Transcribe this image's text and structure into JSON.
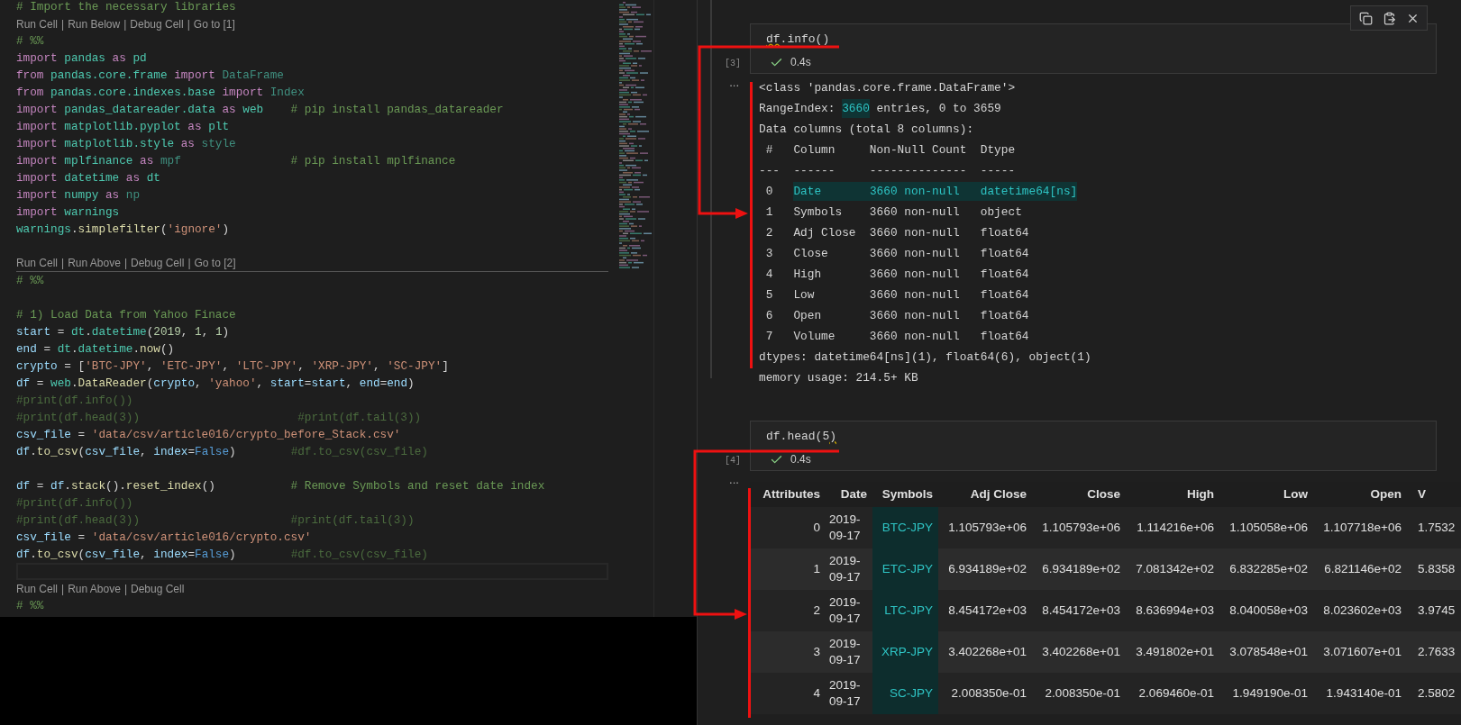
{
  "editor": {
    "codelens_separator": "|",
    "lines": [
      {
        "kind": "code",
        "segments": [
          {
            "kind": "cmt",
            "text": "# Import the necessary libraries"
          }
        ]
      },
      {
        "kind": "codelens",
        "divider": false,
        "items": [
          "Run Cell",
          "Run Below",
          "Debug Cell",
          "Go to [1]"
        ]
      },
      {
        "kind": "code",
        "segments": [
          {
            "kind": "cmt",
            "text": "# %%"
          }
        ]
      },
      {
        "kind": "code",
        "segments": [
          {
            "kind": "kw",
            "text": "import "
          },
          {
            "kind": "mod",
            "text": "pandas "
          },
          {
            "kind": "kw",
            "text": "as "
          },
          {
            "kind": "mod",
            "text": "pd"
          }
        ]
      },
      {
        "kind": "code",
        "segments": [
          {
            "kind": "kw",
            "text": "from "
          },
          {
            "kind": "mod",
            "text": "pandas.core.frame "
          },
          {
            "kind": "kw",
            "text": "import "
          },
          {
            "kind": "dim",
            "text": "DataFrame"
          }
        ]
      },
      {
        "kind": "code",
        "segments": [
          {
            "kind": "kw",
            "text": "from "
          },
          {
            "kind": "mod",
            "text": "pandas.core.indexes.base "
          },
          {
            "kind": "kw",
            "text": "import "
          },
          {
            "kind": "dim",
            "text": "Index"
          }
        ]
      },
      {
        "kind": "code",
        "segments": [
          {
            "kind": "kw",
            "text": "import "
          },
          {
            "kind": "mod",
            "text": "pandas_datareader.data "
          },
          {
            "kind": "kw",
            "text": "as "
          },
          {
            "kind": "mod",
            "text": "web    "
          },
          {
            "kind": "cmt",
            "text": "# pip install pandas_datareader"
          }
        ]
      },
      {
        "kind": "code",
        "segments": [
          {
            "kind": "kw",
            "text": "import "
          },
          {
            "kind": "mod",
            "text": "matplotlib.pyplot "
          },
          {
            "kind": "kw",
            "text": "as "
          },
          {
            "kind": "mod",
            "text": "plt"
          }
        ]
      },
      {
        "kind": "code",
        "segments": [
          {
            "kind": "kw",
            "text": "import "
          },
          {
            "kind": "mod",
            "text": "matplotlib.style "
          },
          {
            "kind": "kw",
            "text": "as "
          },
          {
            "kind": "dim",
            "text": "style"
          }
        ]
      },
      {
        "kind": "code",
        "segments": [
          {
            "kind": "kw",
            "text": "import "
          },
          {
            "kind": "mod",
            "text": "mplfinance "
          },
          {
            "kind": "kw",
            "text": "as "
          },
          {
            "kind": "dim",
            "text": "mpf                "
          },
          {
            "kind": "cmt",
            "text": "# pip install mplfinance"
          }
        ]
      },
      {
        "kind": "code",
        "segments": [
          {
            "kind": "kw",
            "text": "import "
          },
          {
            "kind": "mod",
            "text": "datetime "
          },
          {
            "kind": "kw",
            "text": "as "
          },
          {
            "kind": "mod",
            "text": "dt"
          }
        ]
      },
      {
        "kind": "code",
        "segments": [
          {
            "kind": "kw",
            "text": "import "
          },
          {
            "kind": "mod",
            "text": "numpy "
          },
          {
            "kind": "kw",
            "text": "as "
          },
          {
            "kind": "dim",
            "text": "np"
          }
        ]
      },
      {
        "kind": "code",
        "segments": [
          {
            "kind": "kw",
            "text": "import "
          },
          {
            "kind": "mod",
            "text": "warnings"
          }
        ]
      },
      {
        "kind": "code",
        "segments": [
          {
            "kind": "mod",
            "text": "warnings"
          },
          {
            "kind": "plain",
            "text": "."
          },
          {
            "kind": "fn",
            "text": "simplefilter"
          },
          {
            "kind": "plain",
            "text": "("
          },
          {
            "kind": "str",
            "text": "'ignore'"
          },
          {
            "kind": "plain",
            "text": ")"
          }
        ]
      },
      {
        "kind": "blank",
        "current": false
      },
      {
        "kind": "codelens",
        "divider": true,
        "items": [
          "Run Cell",
          "Run Above",
          "Debug Cell",
          "Go to [2]"
        ]
      },
      {
        "kind": "code",
        "segments": [
          {
            "kind": "cmt",
            "text": "# %%"
          }
        ]
      },
      {
        "kind": "blank",
        "current": false
      },
      {
        "kind": "code",
        "segments": [
          {
            "kind": "cmt",
            "text": "# 1) Load Data from Yahoo Finace"
          }
        ]
      },
      {
        "kind": "code",
        "segments": [
          {
            "kind": "var",
            "text": "start"
          },
          {
            "kind": "plain",
            "text": " = "
          },
          {
            "kind": "mod",
            "text": "dt"
          },
          {
            "kind": "plain",
            "text": "."
          },
          {
            "kind": "mod",
            "text": "datetime"
          },
          {
            "kind": "plain",
            "text": "("
          },
          {
            "kind": "num",
            "text": "2019"
          },
          {
            "kind": "plain",
            "text": ", "
          },
          {
            "kind": "num",
            "text": "1"
          },
          {
            "kind": "plain",
            "text": ", "
          },
          {
            "kind": "num",
            "text": "1"
          },
          {
            "kind": "plain",
            "text": ")"
          }
        ]
      },
      {
        "kind": "code",
        "segments": [
          {
            "kind": "var",
            "text": "end"
          },
          {
            "kind": "plain",
            "text": " = "
          },
          {
            "kind": "mod",
            "text": "dt"
          },
          {
            "kind": "plain",
            "text": "."
          },
          {
            "kind": "mod",
            "text": "datetime"
          },
          {
            "kind": "plain",
            "text": "."
          },
          {
            "kind": "fn",
            "text": "now"
          },
          {
            "kind": "plain",
            "text": "()"
          }
        ]
      },
      {
        "kind": "code",
        "segments": [
          {
            "kind": "var",
            "text": "crypto"
          },
          {
            "kind": "plain",
            "text": " = ["
          },
          {
            "kind": "str",
            "text": "'BTC-JPY'"
          },
          {
            "kind": "plain",
            "text": ", "
          },
          {
            "kind": "str",
            "text": "'ETC-JPY'"
          },
          {
            "kind": "plain",
            "text": ", "
          },
          {
            "kind": "str",
            "text": "'LTC-JPY'"
          },
          {
            "kind": "plain",
            "text": ", "
          },
          {
            "kind": "str",
            "text": "'XRP-JPY'"
          },
          {
            "kind": "plain",
            "text": ", "
          },
          {
            "kind": "str",
            "text": "'SC-JPY'"
          },
          {
            "kind": "plain",
            "text": "]"
          }
        ]
      },
      {
        "kind": "code",
        "segments": [
          {
            "kind": "var",
            "text": "df"
          },
          {
            "kind": "plain",
            "text": " = "
          },
          {
            "kind": "mod",
            "text": "web"
          },
          {
            "kind": "plain",
            "text": "."
          },
          {
            "kind": "fn",
            "text": "DataReader"
          },
          {
            "kind": "plain",
            "text": "("
          },
          {
            "kind": "var",
            "text": "crypto"
          },
          {
            "kind": "plain",
            "text": ", "
          },
          {
            "kind": "str",
            "text": "'yahoo'"
          },
          {
            "kind": "plain",
            "text": ", "
          },
          {
            "kind": "var",
            "text": "start"
          },
          {
            "kind": "plain",
            "text": "="
          },
          {
            "kind": "var",
            "text": "start"
          },
          {
            "kind": "plain",
            "text": ", "
          },
          {
            "kind": "var",
            "text": "end"
          },
          {
            "kind": "plain",
            "text": "="
          },
          {
            "kind": "var",
            "text": "end"
          },
          {
            "kind": "plain",
            "text": ")"
          }
        ]
      },
      {
        "kind": "code",
        "segments": [
          {
            "kind": "dimcmt",
            "text": "#print(df.info())"
          }
        ]
      },
      {
        "kind": "code",
        "segments": [
          {
            "kind": "dimcmt",
            "text": "#print(df.head(3))                       #print(df.tail(3))"
          }
        ]
      },
      {
        "kind": "code",
        "segments": [
          {
            "kind": "var",
            "text": "csv_file"
          },
          {
            "kind": "plain",
            "text": " = "
          },
          {
            "kind": "str",
            "text": "'data/csv/article016/crypto_before_Stack.csv'"
          }
        ]
      },
      {
        "kind": "code",
        "segments": [
          {
            "kind": "var",
            "text": "df"
          },
          {
            "kind": "plain",
            "text": "."
          },
          {
            "kind": "fn",
            "text": "to_csv"
          },
          {
            "kind": "plain",
            "text": "("
          },
          {
            "kind": "var",
            "text": "csv_file"
          },
          {
            "kind": "plain",
            "text": ", "
          },
          {
            "kind": "var",
            "text": "index"
          },
          {
            "kind": "plain",
            "text": "="
          },
          {
            "kind": "const",
            "text": "False"
          },
          {
            "kind": "plain",
            "text": ")        "
          },
          {
            "kind": "dimcmt",
            "text": "#df.to_csv(csv_file)"
          }
        ]
      },
      {
        "kind": "blank",
        "current": false
      },
      {
        "kind": "code",
        "segments": [
          {
            "kind": "var",
            "text": "df"
          },
          {
            "kind": "plain",
            "text": " = "
          },
          {
            "kind": "var",
            "text": "df"
          },
          {
            "kind": "plain",
            "text": "."
          },
          {
            "kind": "fn",
            "text": "stack"
          },
          {
            "kind": "plain",
            "text": "()."
          },
          {
            "kind": "fn",
            "text": "reset_index"
          },
          {
            "kind": "plain",
            "text": "()           "
          },
          {
            "kind": "cmt",
            "text": "# Remove Symbols and reset date index"
          }
        ]
      },
      {
        "kind": "code",
        "segments": [
          {
            "kind": "dimcmt",
            "text": "#print(df.info())"
          }
        ]
      },
      {
        "kind": "code",
        "segments": [
          {
            "kind": "dimcmt",
            "text": "#print(df.head(3))                      #print(df.tail(3))"
          }
        ]
      },
      {
        "kind": "code",
        "segments": [
          {
            "kind": "var",
            "text": "csv_file"
          },
          {
            "kind": "plain",
            "text": " = "
          },
          {
            "kind": "str",
            "text": "'data/csv/article016/crypto.csv'"
          }
        ]
      },
      {
        "kind": "code",
        "segments": [
          {
            "kind": "var",
            "text": "df"
          },
          {
            "kind": "plain",
            "text": "."
          },
          {
            "kind": "fn",
            "text": "to_csv"
          },
          {
            "kind": "plain",
            "text": "("
          },
          {
            "kind": "var",
            "text": "csv_file"
          },
          {
            "kind": "plain",
            "text": ", "
          },
          {
            "kind": "var",
            "text": "index"
          },
          {
            "kind": "plain",
            "text": "="
          },
          {
            "kind": "const",
            "text": "False"
          },
          {
            "kind": "plain",
            "text": ")        "
          },
          {
            "kind": "dimcmt",
            "text": "#df.to_csv(csv_file)"
          }
        ]
      },
      {
        "kind": "blank",
        "current": true
      },
      {
        "kind": "codelens",
        "divider": false,
        "items": [
          "Run Cell",
          "Run Above",
          "Debug Cell"
        ]
      },
      {
        "kind": "code",
        "segments": [
          {
            "kind": "cmt",
            "text": "# %%"
          }
        ]
      }
    ]
  },
  "notebook": {
    "cells": [
      {
        "execution_count": "[3]",
        "code": [
          {
            "text": "df",
            "warning": true
          },
          {
            "text": ".info()",
            "warning": false
          }
        ],
        "succeeded": true,
        "duration": "0.4s",
        "output_marker": "...",
        "output": {
          "kind": "text",
          "lines": [
            [
              {
                "text": "<class 'pandas.core.frame.DataFrame'>",
                "highlighted": false
              }
            ],
            [
              {
                "text": "RangeIndex: ",
                "highlighted": false
              },
              {
                "text": "3660",
                "highlighted": true
              },
              {
                "text": " entries, 0 to 3659",
                "highlighted": false
              }
            ],
            [
              {
                "text": "Data columns (total 8 columns):",
                "highlighted": false
              }
            ],
            [
              {
                "text": " #   Column     Non-Null Count  Dtype",
                "highlighted": false
              }
            ],
            [
              {
                "text": "---  ------     --------------  -----",
                "highlighted": false
              }
            ],
            [
              {
                "text": " 0   ",
                "highlighted": false
              },
              {
                "text": "Date       3660 non-null   datetime64[ns]",
                "highlighted": true
              }
            ],
            [
              {
                "text": " 1   Symbols    3660 non-null   object",
                "highlighted": false
              }
            ],
            [
              {
                "text": " 2   Adj Close  3660 non-null   float64",
                "highlighted": false
              }
            ],
            [
              {
                "text": " 3   Close      3660 non-null   float64",
                "highlighted": false
              }
            ],
            [
              {
                "text": " 4   High       3660 non-null   float64",
                "highlighted": false
              }
            ],
            [
              {
                "text": " 5   Low        3660 non-null   float64",
                "highlighted": false
              }
            ],
            [
              {
                "text": " 6   Open       3660 non-null   float64",
                "highlighted": false
              }
            ],
            [
              {
                "text": " 7   Volume     3660 non-null   float64",
                "highlighted": false
              }
            ],
            [
              {
                "text": "dtypes: datetime64[ns](1), float64(6), object(1)",
                "highlighted": false
              }
            ],
            [
              {
                "text": "memory usage: 214.5+ KB",
                "highlighted": false
              }
            ]
          ]
        }
      },
      {
        "execution_count": "[4]",
        "code": [
          {
            "text": "df.head(5",
            "warning": false
          },
          {
            "text": ")",
            "warning": true
          }
        ],
        "succeeded": true,
        "duration": "0.4s",
        "output_marker": "...",
        "output": {
          "kind": "table",
          "index_header": "Attributes",
          "columns": [
            {
              "label": "Date",
              "highlighted": false
            },
            {
              "label": "Symbols",
              "highlighted": true
            },
            {
              "label": "Adj Close",
              "highlighted": false
            },
            {
              "label": "Close",
              "highlighted": false
            },
            {
              "label": "High",
              "highlighted": false
            },
            {
              "label": "Low",
              "highlighted": false
            },
            {
              "label": "Open",
              "highlighted": false
            },
            {
              "label": "V",
              "highlighted": false
            }
          ],
          "rows": [
            {
              "index": "0",
              "cells": [
                "2019-09-17",
                "BTC-JPY",
                "1.105793e+06",
                "1.105793e+06",
                "1.114216e+06",
                "1.105058e+06",
                "1.107718e+06",
                "1.7532"
              ]
            },
            {
              "index": "1",
              "cells": [
                "2019-09-17",
                "ETC-JPY",
                "6.934189e+02",
                "6.934189e+02",
                "7.081342e+02",
                "6.832285e+02",
                "6.821146e+02",
                "5.8358"
              ]
            },
            {
              "index": "2",
              "cells": [
                "2019-09-17",
                "LTC-JPY",
                "8.454172e+03",
                "8.454172e+03",
                "8.636994e+03",
                "8.040058e+03",
                "8.023602e+03",
                "3.9745"
              ]
            },
            {
              "index": "3",
              "cells": [
                "2019-09-17",
                "XRP-JPY",
                "3.402268e+01",
                "3.402268e+01",
                "3.491802e+01",
                "3.078548e+01",
                "3.071607e+01",
                "2.7633"
              ]
            },
            {
              "index": "4",
              "cells": [
                "2019-09-17",
                "SC-JPY",
                "2.008350e-01",
                "2.008350e-01",
                "2.069460e-01",
                "1.949190e-01",
                "1.943140e-01",
                "2.5802"
              ]
            }
          ]
        }
      }
    ]
  }
}
